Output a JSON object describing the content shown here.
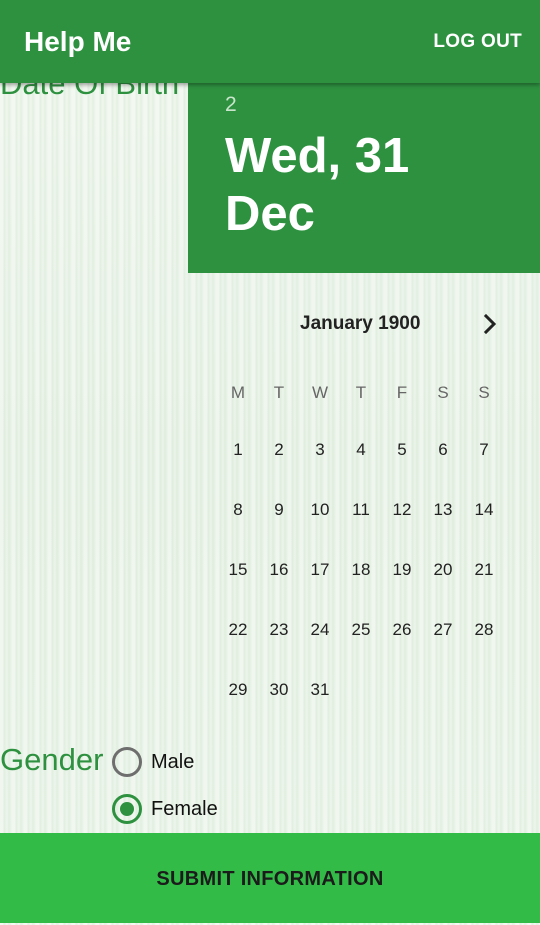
{
  "appbar": {
    "title": "Help Me",
    "logout_label": "LOG OUT"
  },
  "form": {
    "dob_label": "Date Of Birth",
    "gender_label": "Gender"
  },
  "date_picker": {
    "header_year": "2",
    "header_date": "Wed, 31 Dec",
    "month_title": "January 1900",
    "next_icon": "chevron-right-icon",
    "weekdays": [
      "M",
      "T",
      "W",
      "T",
      "F",
      "S",
      "S"
    ],
    "days": [
      "1",
      "2",
      "3",
      "4",
      "5",
      "6",
      "7",
      "8",
      "9",
      "10",
      "11",
      "12",
      "13",
      "14",
      "15",
      "16",
      "17",
      "18",
      "19",
      "20",
      "21",
      "22",
      "23",
      "24",
      "25",
      "26",
      "27",
      "28",
      "29",
      "30",
      "31"
    ]
  },
  "gender": {
    "options": [
      {
        "label": "Male",
        "checked": false
      },
      {
        "label": "Female",
        "checked": true
      }
    ]
  },
  "submit_label": "SUBMIT INFORMATION",
  "colors": {
    "primary": "#2e9140",
    "button": "#33bb47",
    "label": "#2e9140"
  }
}
